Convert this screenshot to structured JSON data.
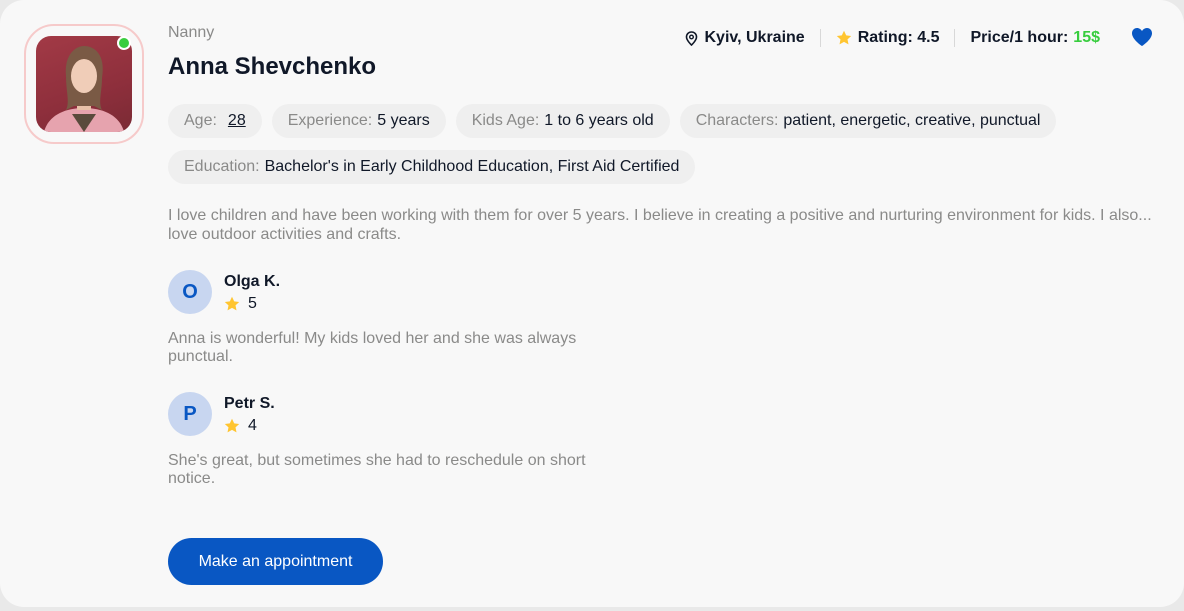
{
  "profile": {
    "role": "Nanny",
    "name": "Anna Shevchenko",
    "online": true
  },
  "meta": {
    "location": "Kyiv, Ukraine",
    "rating_label": "Rating: 4.5",
    "price_label": "Price/1 hour:",
    "price_value": "15$"
  },
  "details": {
    "age_label": "Age:",
    "age_value": "28",
    "experience_label": "Experience:",
    "experience_value": "5 years",
    "kids_age_label": "Kids Age:",
    "kids_age_value": "1 to 6 years old",
    "characters_label": "Characters:",
    "characters_value": "patient, energetic, creative, punctual",
    "education_label": "Education:",
    "education_value": "Bachelor's in Early Childhood Education, First Aid Certified"
  },
  "about": "I love children and have been working with them for over 5 years. I believe in creating a positive and nurturing environment for kids. I also... love outdoor activities and crafts.",
  "reviews": [
    {
      "initial": "O",
      "name": "Olga K.",
      "rating": "5",
      "text": "Anna is wonderful! My kids loved her and she was always punctual."
    },
    {
      "initial": "P",
      "name": "Petr S.",
      "rating": "4",
      "text": "She's great, but sometimes she had to reschedule on short notice."
    }
  ],
  "actions": {
    "appointment_label": "Make an appointment"
  },
  "colors": {
    "accent": "#0957c3",
    "price": "#38cd3e",
    "star": "#ffc531",
    "online": "#38cd3e",
    "avatar_border": "#f6caca"
  },
  "icons": {
    "location": "map-pin-icon",
    "rating": "star-icon",
    "favorite": "heart-icon"
  }
}
